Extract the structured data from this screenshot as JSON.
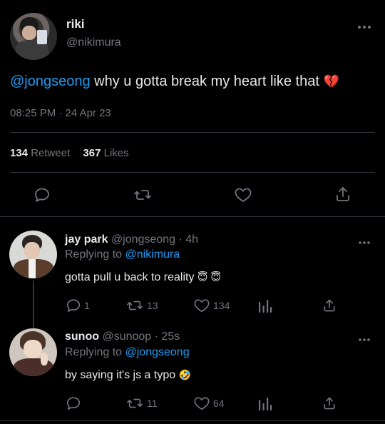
{
  "main_tweet": {
    "display_name": "riki",
    "handle": "@nikimura",
    "mention": "@jongseong",
    "text": " why u gotta break my heart like that",
    "emoji": "💔",
    "timestamp": "08:25 PM · 24 Apr 23",
    "retweets": "134",
    "retweets_label": "Retweet",
    "likes": "367",
    "likes_label": "Likes"
  },
  "replies": [
    {
      "display_name": "jay park",
      "handle": "@jongseong",
      "time": "· 4h",
      "replying_label": "Replying to",
      "replying_to": "@nikimura",
      "text": "gotta pull u back to reality",
      "emoji": "😇 😇",
      "replies": "1",
      "retweets": "13",
      "likes": "134"
    },
    {
      "display_name": "sunoo",
      "handle": "@sunoop",
      "time": "· 25s",
      "replying_label": "Replying to",
      "replying_to": "@jongseong",
      "text": "by saying it's js a typo",
      "emoji": "🤣",
      "replies": "",
      "retweets": "11",
      "likes": "64"
    }
  ],
  "colors": {
    "background": "#000000",
    "text": "#e7e9ea",
    "muted": "#71767b",
    "link": "#1d9bf0",
    "divider": "#2f3336"
  },
  "icons": [
    "more-icon",
    "reply-icon",
    "retweet-icon",
    "like-icon",
    "share-icon",
    "analytics-icon"
  ]
}
